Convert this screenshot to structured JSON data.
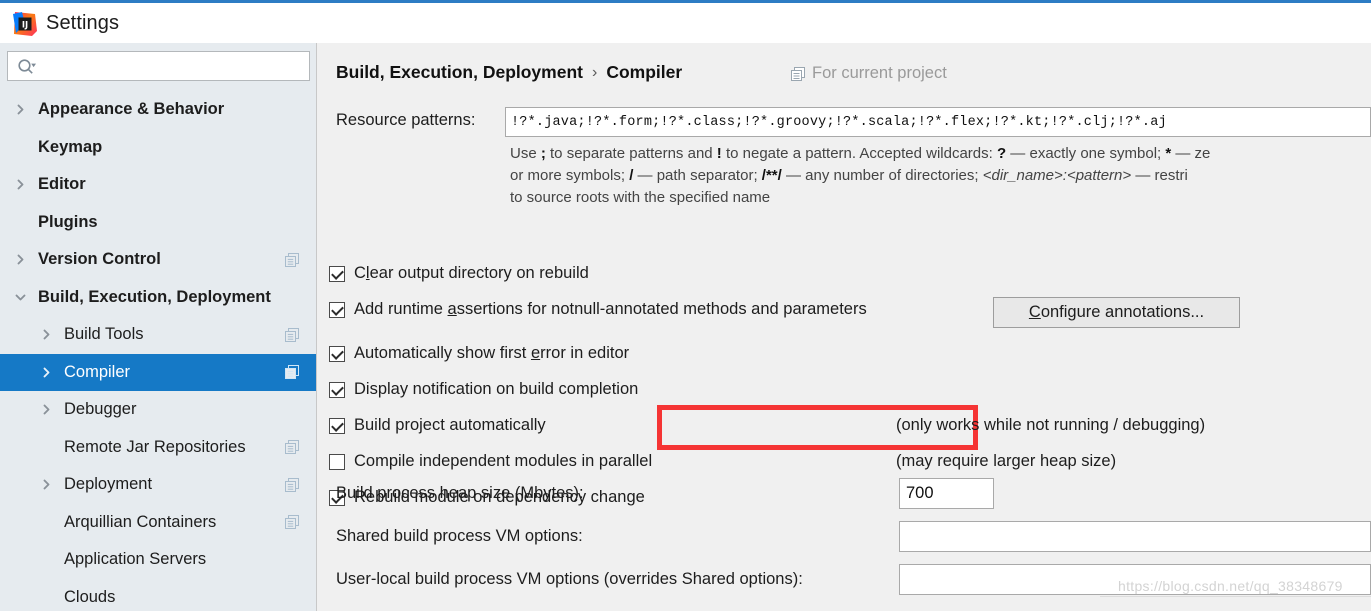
{
  "window": {
    "title": "Settings",
    "logo_icon": "intellij-idea-logo",
    "accent_color": "#2d7cc4"
  },
  "sidebar": {
    "search": {
      "icon": "search-icon",
      "value": "",
      "placeholder": ""
    },
    "selection_color": "#1579c6",
    "items": [
      {
        "label": "Appearance & Behavior",
        "level": 0,
        "twisty": "chevron-right",
        "copy_badge": false,
        "selected": false
      },
      {
        "label": "Keymap",
        "level": 0,
        "twisty": "none",
        "copy_badge": false,
        "selected": false
      },
      {
        "label": "Editor",
        "level": 0,
        "twisty": "chevron-right",
        "copy_badge": false,
        "selected": false
      },
      {
        "label": "Plugins",
        "level": 0,
        "twisty": "none",
        "copy_badge": false,
        "selected": false
      },
      {
        "label": "Version Control",
        "level": 0,
        "twisty": "chevron-right",
        "copy_badge": true,
        "selected": false
      },
      {
        "label": "Build, Execution, Deployment",
        "level": 0,
        "twisty": "chevron-down",
        "copy_badge": false,
        "selected": false
      },
      {
        "label": "Build Tools",
        "level": 1,
        "twisty": "chevron-right",
        "copy_badge": true,
        "selected": false
      },
      {
        "label": "Compiler",
        "level": 1,
        "twisty": "chevron-right",
        "copy_badge": true,
        "selected": true
      },
      {
        "label": "Debugger",
        "level": 1,
        "twisty": "chevron-right",
        "copy_badge": false,
        "selected": false
      },
      {
        "label": "Remote Jar Repositories",
        "level": 1,
        "twisty": "none",
        "copy_badge": true,
        "selected": false
      },
      {
        "label": "Deployment",
        "level": 1,
        "twisty": "chevron-right",
        "copy_badge": true,
        "selected": false
      },
      {
        "label": "Arquillian Containers",
        "level": 1,
        "twisty": "none",
        "copy_badge": true,
        "selected": false
      },
      {
        "label": "Application Servers",
        "level": 1,
        "twisty": "none",
        "copy_badge": false,
        "selected": false
      },
      {
        "label": "Clouds",
        "level": 1,
        "twisty": "none",
        "copy_badge": false,
        "selected": false
      }
    ]
  },
  "main": {
    "breadcrumb": {
      "parent": "Build, Execution, Deployment",
      "separator": "›",
      "current": "Compiler"
    },
    "scope": {
      "icon": "copy-icon",
      "text": "For current project"
    },
    "resource_patterns": {
      "label": "Resource patterns:",
      "value": "!?*.java;!?*.form;!?*.class;!?*.groovy;!?*.scala;!?*.flex;!?*.kt;!?*.clj;!?*.aj",
      "placeholder": ""
    },
    "hint": {
      "line1_a": "Use ",
      "line1_b": ";",
      "line1_c": " to separate patterns and ",
      "line1_d": "!",
      "line1_e": " to negate a pattern. Accepted wildcards: ",
      "line1_f": "?",
      "line1_g": " — exactly one symbol; ",
      "line1_h": "*",
      "line1_i": " — ze",
      "line2_a": "or more symbols; ",
      "line2_b": "/",
      "line2_c": " — path separator; ",
      "line2_d": "/**/",
      "line2_e": " — any number of directories; ",
      "line2_f": "<dir_name>:<pattern>",
      "line2_g": " — restri",
      "line3": "to source roots with the specified name"
    },
    "checkboxes": [
      {
        "pre": "C",
        "mnemonic": "l",
        "post": "ear output directory on rebuild",
        "checked": true
      },
      {
        "pre": "Add runtime ",
        "mnemonic": "a",
        "post": "ssertions for notnull-annotated methods and parameters",
        "checked": true
      },
      {
        "pre": "Automatically show first ",
        "mnemonic": "e",
        "post": "rror in editor",
        "checked": true
      },
      {
        "pre": "Display notification on build completion",
        "mnemonic": "",
        "post": "",
        "checked": true
      },
      {
        "pre": "Build project automatically",
        "mnemonic": "",
        "post": "",
        "checked": true
      },
      {
        "pre": "Compile independent modules in parallel",
        "mnemonic": "",
        "post": "",
        "checked": false
      },
      {
        "pre": "Rebuild module on dependency change",
        "mnemonic": "",
        "post": "",
        "checked": true
      }
    ],
    "configure_annotations_button": {
      "pre": "",
      "mnemonic": "C",
      "post": "onfigure annotations..."
    },
    "note_build_auto": "(only works while not running / debugging)",
    "note_parallel": "(may require larger heap size)",
    "heap": {
      "label": "Build process heap size (Mbytes):",
      "value": "700"
    },
    "shared_vm": {
      "label": "Shared build process VM options:",
      "value": ""
    },
    "user_vm": {
      "label": "User-local build process VM options (overrides Shared options):",
      "value": ""
    },
    "annotation_box_color": "#f53434"
  },
  "watermark": "https://blog.csdn.net/qq_38348679"
}
